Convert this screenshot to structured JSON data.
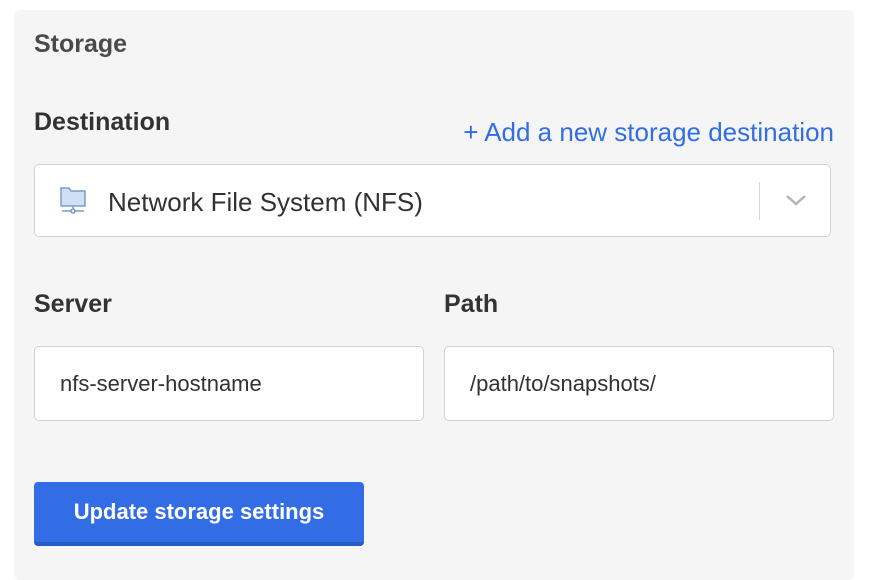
{
  "storage": {
    "title": "Storage",
    "destination": {
      "label": "Destination",
      "add_link": "+ Add a new storage destination",
      "selected_value": "Network File System (NFS)",
      "selected_icon": "network-folder-icon",
      "dropdown_icon": "chevron-down-icon"
    },
    "server": {
      "label": "Server",
      "value": "nfs-server-hostname"
    },
    "path": {
      "label": "Path",
      "value": "/path/to/snapshots/"
    },
    "submit_label": "Update storage settings"
  },
  "colors": {
    "accent": "#326de6",
    "panel_background": "#f5f5f5",
    "text": "#323232"
  }
}
